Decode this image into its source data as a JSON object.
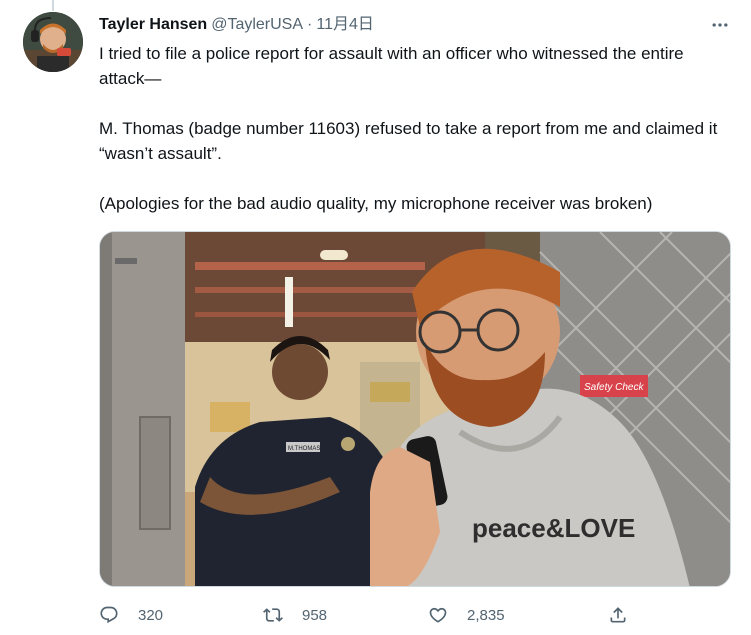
{
  "tweet": {
    "display_name": "Tayler Hansen",
    "handle": "@TaylerUSA",
    "separator": "·",
    "timestamp": "11月4日",
    "text": [
      "I tried to file a police report for assault with an officer who witnessed the entire attack—",
      "M. Thomas (badge number 11603) refused to take a report from me and claimed it “wasn’t assault”.",
      "(Apologies for the bad audio quality, my microphone receiver was broken)"
    ],
    "media": {
      "officer_name_tag": "M.THOMAS",
      "hoodie_print": "peace&LOVE",
      "sign_text": "Safety Check"
    }
  },
  "actions": {
    "reply_count": "320",
    "retweet_count": "958",
    "like_count": "2,835"
  },
  "icons": {
    "more": "more-horizontal-icon",
    "reply": "reply-icon",
    "retweet": "retweet-icon",
    "like": "heart-icon",
    "share": "share-icon"
  },
  "colors": {
    "text_primary": "#0f1419",
    "text_secondary": "#536471",
    "border": "#cfd9de"
  }
}
